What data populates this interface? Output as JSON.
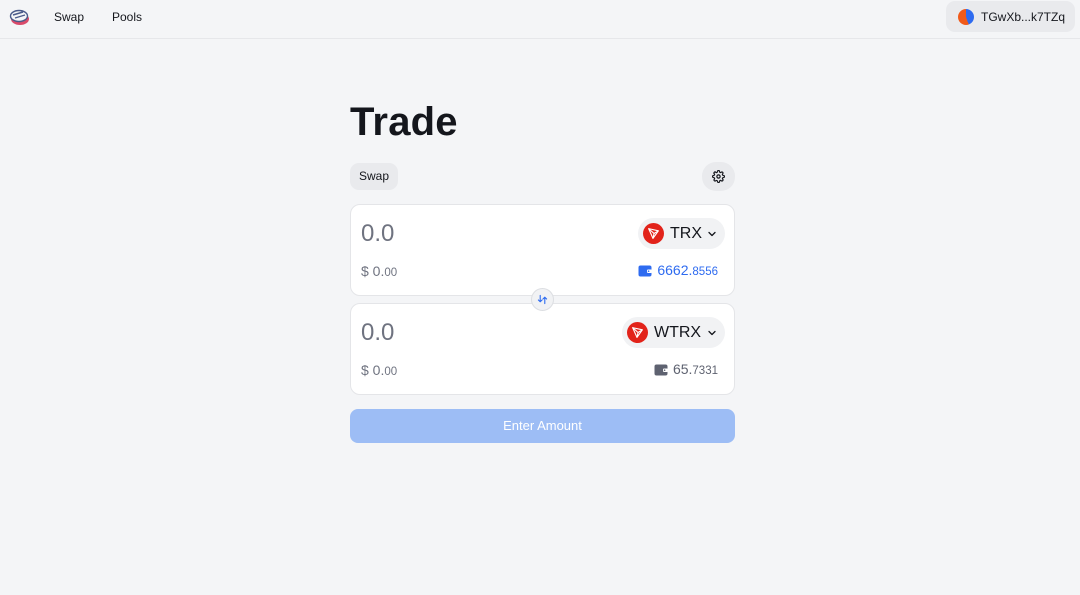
{
  "nav": {
    "logo_icon": "app-logo-icon",
    "links": [
      "Swap",
      "Pools"
    ]
  },
  "wallet": {
    "address": "TGwXb...k7TZq"
  },
  "page": {
    "title": "Trade"
  },
  "tabs": {
    "active": "Swap"
  },
  "from": {
    "placeholder": "0.0",
    "usd_main": "$ 0.",
    "usd_small": "00",
    "token": "TRX",
    "balance_main": "6662.",
    "balance_small": "8556"
  },
  "to": {
    "placeholder": "0.0",
    "usd_main": "$ 0.",
    "usd_small": "00",
    "token": "WTRX",
    "balance_main": "65.",
    "balance_small": "7331"
  },
  "submit": {
    "label": "Enter Amount"
  },
  "colors": {
    "accent": "#2e6bf0",
    "button_disabled": "#9dbdf5",
    "tron_red": "#e2231a"
  }
}
